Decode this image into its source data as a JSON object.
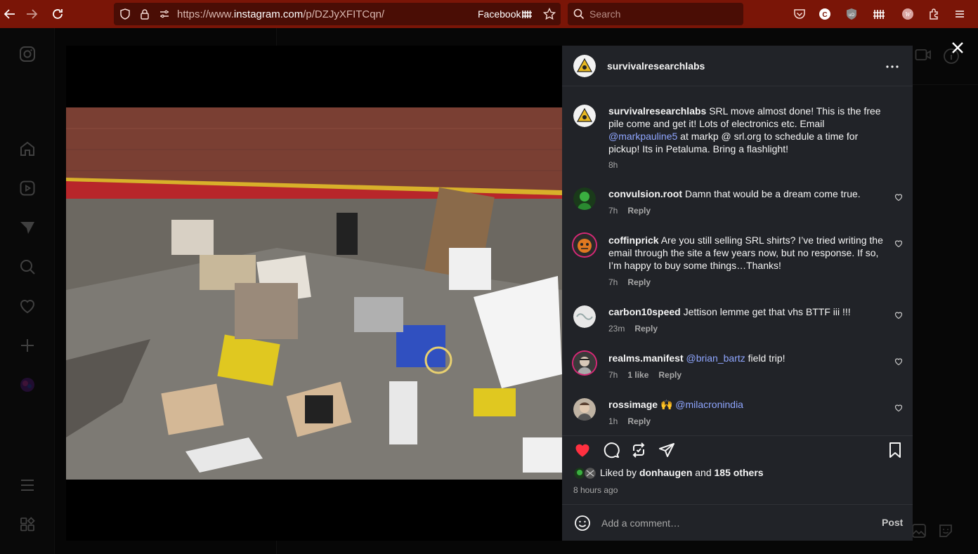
{
  "browser": {
    "url_prefix": "https://www.",
    "url_host": "instagram.com",
    "url_path": "/p/DZJyXFITCqn/",
    "container_label": "Facebook",
    "search_placeholder": "Search"
  },
  "post": {
    "author": "survivalresearchlabs",
    "caption_parts": {
      "before_mention": "SRL move almost done! This is the free pile come and get it! Lots of electronics etc. Email ",
      "mention": "@markpauline5",
      "after_mention": " at markp @ srl.org to schedule a time for pickup! Its in Petaluma. Bring a flashlight!"
    },
    "caption_time": "8h",
    "comments": [
      {
        "user": "convulsion.root",
        "text": "Damn that would be a dream come true.",
        "time": "7h",
        "reply": "Reply"
      },
      {
        "user": "coffinprick",
        "text": "Are you still selling SRL shirts? I’ve tried writing the email through the site a few years now, but no response. If so, I’m happy to buy some things…Thanks!",
        "time": "7h",
        "reply": "Reply"
      },
      {
        "user": "carbon10speed",
        "text": "Jettison lemme get that vhs BTTF iii !!!",
        "time": "23m",
        "reply": "Reply"
      },
      {
        "user": "realms.manifest",
        "mention": "@brian_bartz",
        "text": " field trip!",
        "time": "7h",
        "likes": "1 like",
        "reply": "Reply"
      },
      {
        "user": "rossimage",
        "emoji": "🙌",
        "mention": "@milacronindia",
        "time": "1h",
        "reply": "Reply"
      }
    ],
    "liked_by_prefix": "Liked by",
    "liked_by_user": "donhaugen",
    "liked_by_and": "and",
    "liked_by_others": "185 others",
    "posted_ago": "8 hours ago",
    "comment_placeholder": "Add a comment…",
    "post_button": "Post"
  },
  "colors": {
    "browser_toolbar": "#7a1507",
    "panel": "#212328",
    "like_red": "#ff3040",
    "mention_blue": "#8fa6ff"
  }
}
